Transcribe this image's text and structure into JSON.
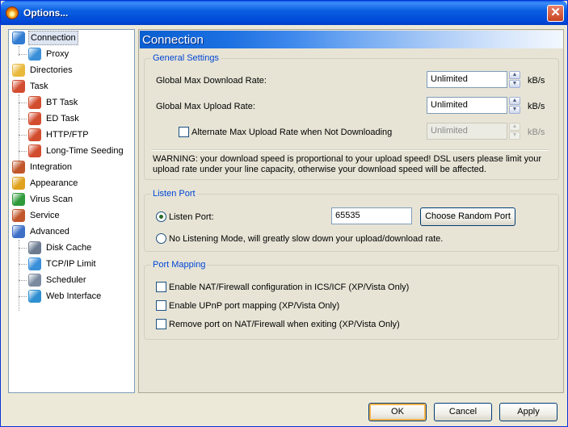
{
  "window": {
    "title": "Options...",
    "close_glyph": "✕"
  },
  "tree": {
    "items": [
      {
        "label": "Connection",
        "icon": "connection-icon",
        "color": "#2e7bd1"
      },
      {
        "label": "Proxy",
        "icon": "proxy-icon",
        "color": "#3a8fd9"
      },
      {
        "label": "Directories",
        "icon": "folder-icon",
        "color": "#e9b93c"
      },
      {
        "label": "Task",
        "icon": "task-icon",
        "color": "#d24c2e"
      },
      {
        "label": "BT Task",
        "icon": "bt-task-icon",
        "color": "#d24c2e"
      },
      {
        "label": "ED Task",
        "icon": "ed-task-icon",
        "color": "#d24c2e"
      },
      {
        "label": "HTTP/FTP",
        "icon": "http-ftp-icon",
        "color": "#d24c2e"
      },
      {
        "label": "Long-Time Seeding",
        "icon": "seeding-icon",
        "color": "#d24c2e"
      },
      {
        "label": "Integration",
        "icon": "integration-icon",
        "color": "#c0562a"
      },
      {
        "label": "Appearance",
        "icon": "appearance-icon",
        "color": "#e0a21c"
      },
      {
        "label": "Virus Scan",
        "icon": "shield-icon",
        "color": "#2e9a3a"
      },
      {
        "label": "Service",
        "icon": "service-icon",
        "color": "#c0562a"
      },
      {
        "label": "Advanced",
        "icon": "advanced-icon",
        "color": "#3d6fc6"
      },
      {
        "label": "Disk Cache",
        "icon": "disk-cache-icon",
        "color": "#6b7a8f"
      },
      {
        "label": "TCP/IP Limit",
        "icon": "tcpip-icon",
        "color": "#3a8fd9"
      },
      {
        "label": "Scheduler",
        "icon": "scheduler-icon",
        "color": "#7c8aa0"
      },
      {
        "label": "Web Interface",
        "icon": "globe-icon",
        "color": "#2f8fd0"
      }
    ]
  },
  "panel": {
    "title": "Connection",
    "general": {
      "title": "General Settings",
      "download_label": "Global Max Download Rate:",
      "download_value": "Unlimited",
      "upload_label": "Global Max Upload Rate:",
      "upload_value": "Unlimited",
      "alternate_label": "Alternate Max Upload Rate when Not Downloading",
      "alternate_value": "Unlimited",
      "unit": "kB/s",
      "warning": "WARNING: your download speed is proportional to your upload speed! DSL users please limit your upload rate under your line capacity, otherwise your download speed will be affected."
    },
    "listen": {
      "title": "Listen Port",
      "port_label": "Listen Port:",
      "port_value": "65535",
      "random_button": "Choose Random Port",
      "no_listen_label": "No Listening Mode, will greatly slow down your upload/download rate."
    },
    "mapping": {
      "title": "Port Mapping",
      "nat_label": "Enable NAT/Firewall configuration in ICS/ICF (XP/Vista Only)",
      "upnp_label": "Enable UPnP port mapping (XP/Vista Only)",
      "remove_label": "Remove port on NAT/Firewall when exiting (XP/Vista Only)"
    }
  },
  "buttons": {
    "ok": "OK",
    "cancel": "Cancel",
    "apply": "Apply"
  },
  "spin": {
    "up": "▲",
    "down": "▼"
  }
}
